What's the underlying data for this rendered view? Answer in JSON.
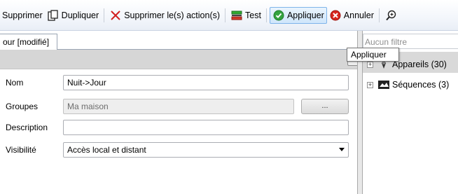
{
  "toolbar": {
    "delete_label": "Supprimer",
    "duplicate_label": "Dupliquer",
    "delete_actions_label": "Supprimer le(s) action(s)",
    "test_label": "Test",
    "apply_label": "Appliquer",
    "cancel_label": "Annuler"
  },
  "tab": {
    "label": "our [modifié]"
  },
  "form": {
    "name_label": "Nom",
    "name_value": "Nuit->Jour",
    "groups_label": "Groupes",
    "groups_value": "Ma maison",
    "groups_browse_label": "...",
    "description_label": "Description",
    "description_value": "",
    "visibility_label": "Visibilité",
    "visibility_value": "Accès local et distant"
  },
  "right_panel": {
    "filter_placeholder": "Aucun filtre",
    "tree": [
      {
        "label": "Appareils (30)",
        "expander": "+"
      },
      {
        "label": "Séquences (3)",
        "expander": "+"
      }
    ]
  },
  "tooltip": {
    "text": "Appliquer"
  },
  "colors": {
    "accent_hover": "#cfe6fb",
    "delete_red": "#d22020",
    "test_green": "#2faa2f",
    "apply_green": "#34a340",
    "cancel_red": "#d7261e"
  }
}
